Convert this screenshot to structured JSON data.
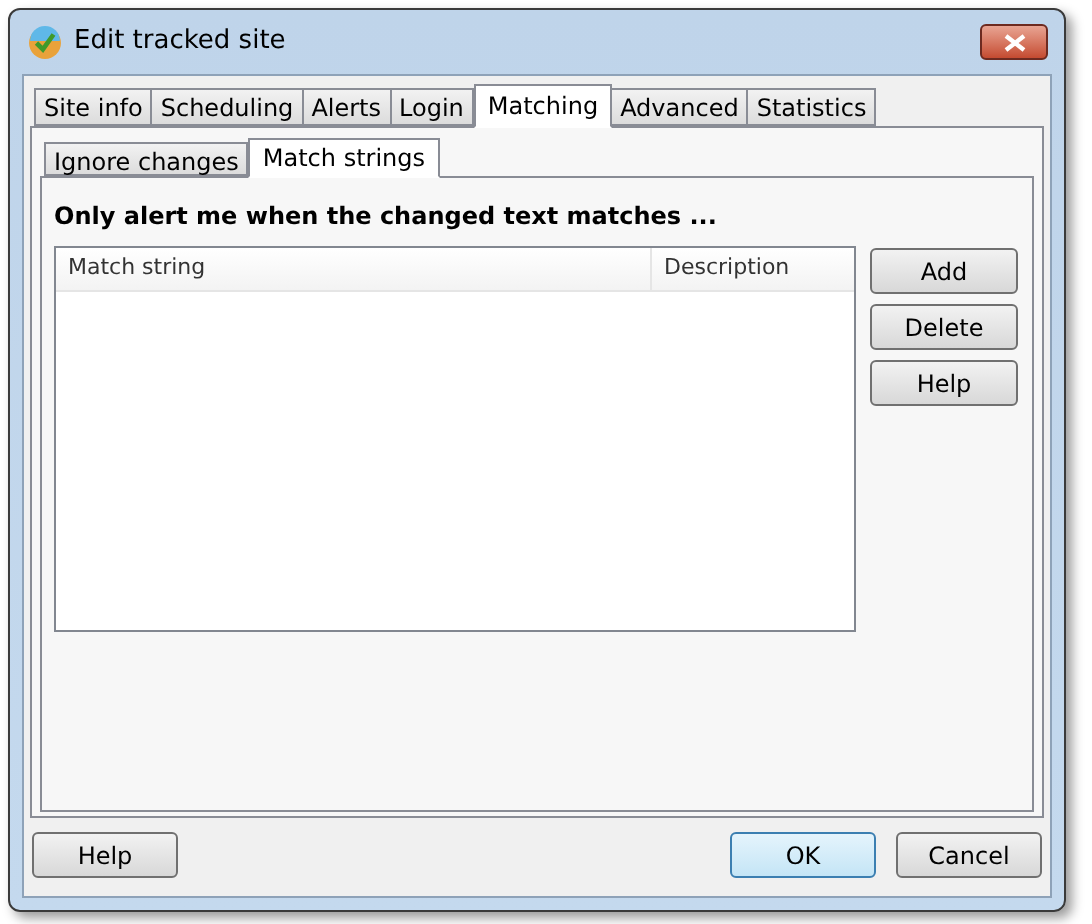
{
  "window": {
    "title": "Edit tracked site"
  },
  "tabs": [
    {
      "label": "Site info",
      "selected": false
    },
    {
      "label": "Scheduling",
      "selected": false
    },
    {
      "label": "Alerts",
      "selected": false
    },
    {
      "label": "Login",
      "selected": false
    },
    {
      "label": "Matching",
      "selected": true
    },
    {
      "label": "Advanced",
      "selected": false
    },
    {
      "label": "Statistics",
      "selected": false
    }
  ],
  "subtabs": [
    {
      "label": "Ignore changes",
      "selected": false
    },
    {
      "label": "Match strings",
      "selected": true
    }
  ],
  "heading": "Only alert me when the changed text matches ...",
  "table": {
    "columns": [
      "Match string",
      "Description"
    ]
  },
  "side_buttons": [
    "Add",
    "Delete",
    "Help"
  ],
  "footer": {
    "left": "Help",
    "buttons": [
      {
        "label": "OK",
        "default": true
      },
      {
        "label": "Cancel",
        "default": false
      }
    ]
  }
}
